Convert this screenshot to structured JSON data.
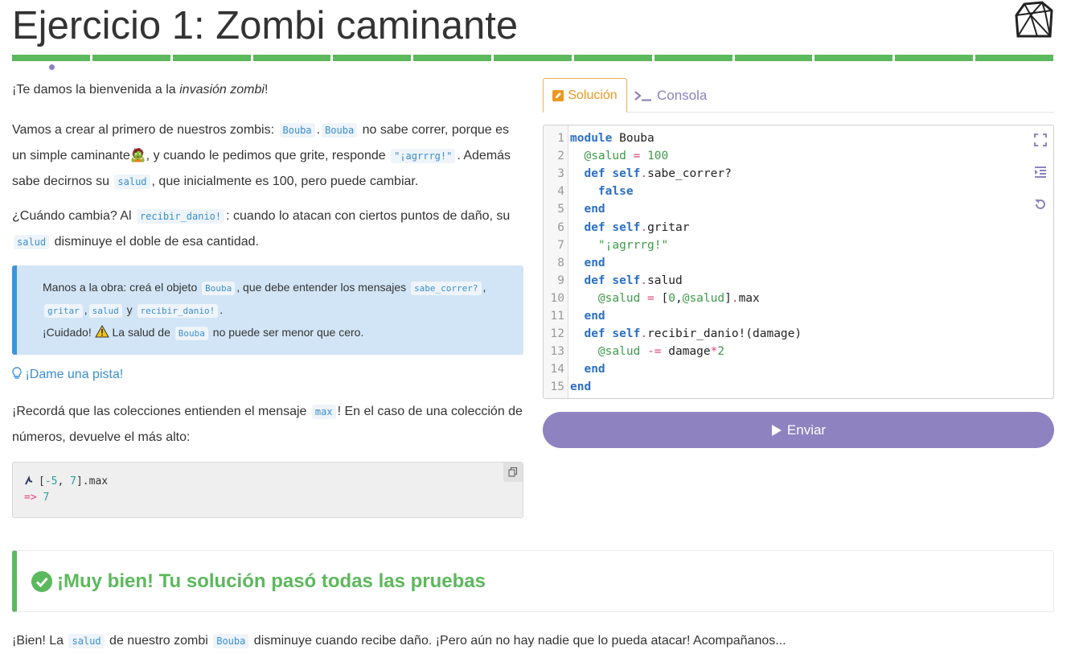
{
  "header": {
    "title": "Ejercicio 1: Zombi caminante",
    "progress_segments": 13,
    "accent": "#5cb85c"
  },
  "intro": {
    "welcome_prefix": "¡Te damos la bienvenida a la ",
    "welcome_em": "invasión zombi",
    "welcome_suffix": "!",
    "p1_a": "Vamos a crear al primero de nuestros zombis: ",
    "p1_code1": "Bouba",
    "p1_dot": ".",
    "p1_code2": "Bouba",
    "p1_b": " no sabe correr, porque es un simple caminante",
    "p1_emoji": "🧟",
    "p1_c": ", y cuando le pedimos que grite, responde ",
    "p1_code3": "\"¡agrrrg!\"",
    "p1_d": ". Además sabe decirnos su ",
    "p1_code4": "salud",
    "p1_e": ", que inicialmente es 100, pero puede cambiar.",
    "p2_a": "¿Cuándo cambia? Al ",
    "p2_code1": "recibir_danio!",
    "p2_b": ": cuando lo atacan con ciertos puntos de daño, su ",
    "p2_code2": "salud",
    "p2_c": " disminuye el doble de esa cantidad."
  },
  "callout": {
    "a": "Manos a la obra: creá el objeto ",
    "code1": "Bouba",
    "b": ", que debe entender los mensajes ",
    "code2": "sabe_correr?",
    "c": ",",
    "code3": "gritar",
    "d": ",",
    "code4": "salud",
    "e": " y ",
    "code5": "recibir_danio!",
    "f": ".",
    "warn_a": "¡Cuidado! ",
    "warn_b": " La salud de ",
    "code6": "Bouba",
    "warn_c": " no puede ser menor que cero."
  },
  "hint": {
    "label": "¡Dame una pista!"
  },
  "remember": {
    "a": "¡Recordá que las colecciones entienden el mensaje ",
    "code": "max",
    "b": "! En el caso de una colección de números, devuelve el más alto:"
  },
  "example": {
    "open": "[",
    "n1": "-5",
    "comma": ", ",
    "n2": "7",
    "close": "].max",
    "arrow": "=>",
    "result": "7"
  },
  "tabs": {
    "solution": "Solución",
    "console": "Consola"
  },
  "editor": {
    "line_numbers": [
      "1",
      "2",
      "3",
      "4",
      "5",
      "6",
      "7",
      "8",
      "9",
      "10",
      "11",
      "12",
      "13",
      "14",
      "15"
    ]
  },
  "submit": {
    "label": "Enviar"
  },
  "result": {
    "title": "¡Muy bien! Tu solución pasó todas las pruebas"
  },
  "final": {
    "a": "¡Bien! La ",
    "code1": "salud",
    "b": " de nuestro zombi ",
    "code2": "Bouba",
    "c": " disminuye cuando recibe daño. ¡Pero aún no hay nadie que lo pueda atacar! Acompañanos..."
  }
}
